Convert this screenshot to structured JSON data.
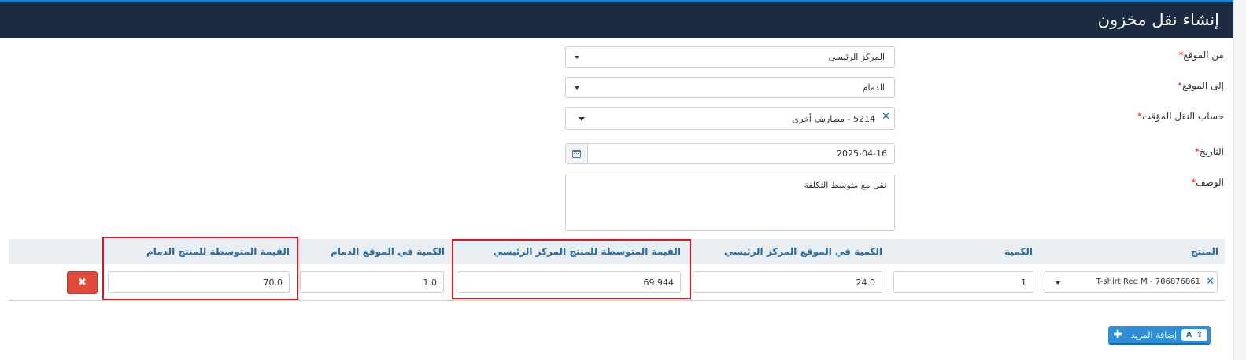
{
  "header": {
    "title": "إنشاء نقل مخزون"
  },
  "form": {
    "required_mark": "*",
    "from_location": {
      "label": "من الموقع",
      "value": "المركز الرئيسى"
    },
    "to_location": {
      "label": "إلى الموقع",
      "value": "الدمام"
    },
    "transit_account": {
      "label": "حساب النقل المؤقت",
      "value": "5214 - مصاريف أخرى"
    },
    "date": {
      "label": "التاريخ",
      "value": "2025-04-16"
    },
    "description": {
      "label": "الوصف",
      "value": "نقل مع متوسط التكلفة"
    }
  },
  "table": {
    "columns": {
      "product": "المنتج",
      "quantity": "الكمية",
      "qty_main": "الكمية في الموقع المركز الرئيسي",
      "avg_main": "القيمة المتوسطة للمنتج المركز الرئيسي",
      "qty_dammam": "الكمية في الموقع الدمام",
      "avg_dammam": "القيمة المتوسطة للمنتج الدمام"
    },
    "rows": [
      {
        "product": "T-shirt Red M - 786876861",
        "quantity": "1",
        "qty_main": "24.0",
        "avg_main": "69.944",
        "qty_dammam": "1.0",
        "avg_dammam": "70.0"
      }
    ]
  },
  "buttons": {
    "add_more": "إضافة المزيد",
    "add_more_shortcut": "A",
    "delete_row_icon": "times-icon"
  },
  "colors": {
    "header_bg": "#1a2b42",
    "accent": "#1e7fc4",
    "column_header_text": "#236aa6",
    "highlight": "#e8121e",
    "delete_button": "#e04a3a",
    "add_button": "#2e8fd8"
  }
}
